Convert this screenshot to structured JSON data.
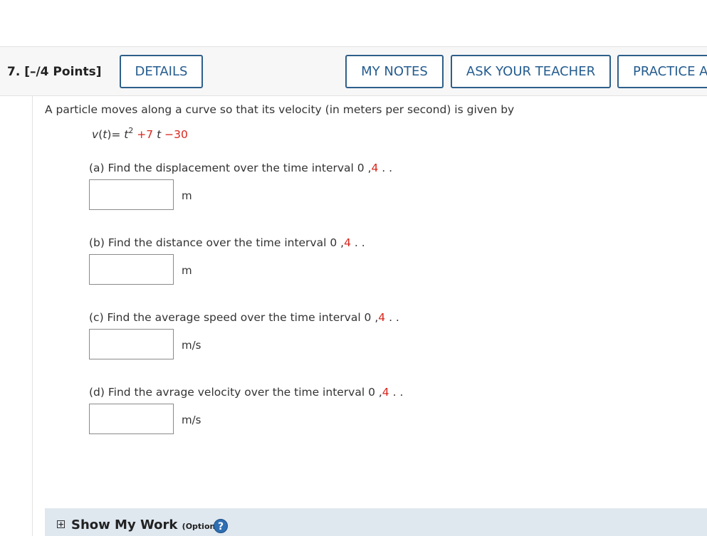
{
  "header": {
    "question_label": "7. [–/4 Points]",
    "details": "DETAILS",
    "my_notes": "MY NOTES",
    "ask_teacher": "ASK YOUR TEACHER",
    "practice": "PRACTICE A"
  },
  "problem": {
    "prompt": "A particle moves along a curve so that its velocity (in meters per second) is given by",
    "equation": {
      "lhs": "v(t)= ",
      "var": "t",
      "exp": "2",
      "term2": " +7",
      "term2_var": " t",
      "term3": " −30"
    }
  },
  "parts": [
    {
      "question": "(a) Find the displacement over the time interval  0 ,",
      "interval_end": "4",
      "tail": " . .",
      "unit": "m"
    },
    {
      "question": "(b) Find the distance over the time interval  0 ,",
      "interval_end": "4",
      "tail": " . .",
      "unit": "m"
    },
    {
      "question": "(c) Find the average speed over the time interval  0 ,",
      "interval_end": "4",
      "tail": " . .",
      "unit": "m/s"
    },
    {
      "question": "(d) Find the avrage velocity over the time interval  0 ,",
      "interval_end": "4",
      "tail": " . .",
      "unit": "m/s"
    }
  ],
  "show_work": {
    "plus": "+",
    "title": "Show My Work",
    "optional": "(Optional)",
    "help": "?"
  },
  "colors": {
    "button_border": "#2e5f8a",
    "button_text": "#245c8f",
    "highlight_red": "#d9261c",
    "show_work_bg": "#dfe7ef"
  }
}
